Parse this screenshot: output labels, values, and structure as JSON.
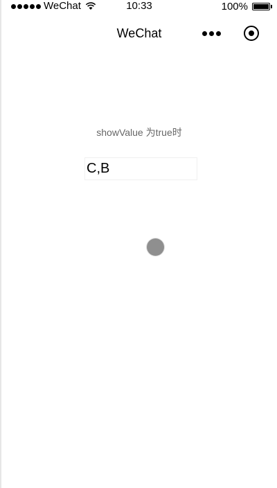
{
  "status_bar": {
    "carrier": "WeChat",
    "time": "10:33",
    "battery": "100%",
    "icons": [
      "signal-icon",
      "wifi-icon",
      "battery-icon"
    ]
  },
  "nav_bar": {
    "title": "WeChat",
    "icons": [
      "more-icon",
      "close-icon"
    ]
  },
  "content": {
    "label": "showValue 为true时",
    "input_value": "C,B"
  },
  "colors": {
    "background": "#ffffff",
    "label_text": "#666666",
    "loading_dot": "#8f8f8f"
  }
}
